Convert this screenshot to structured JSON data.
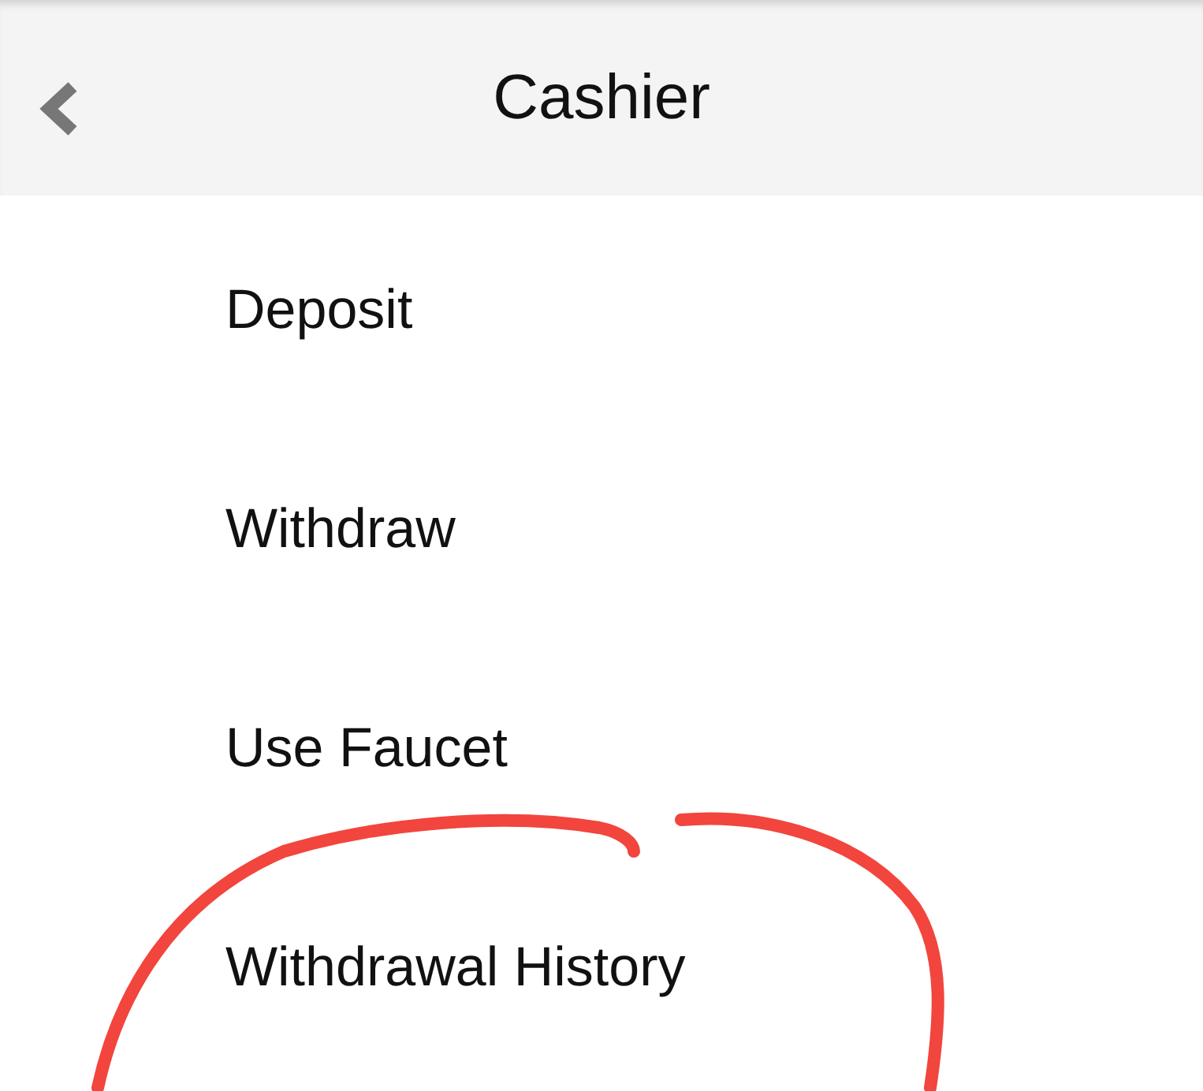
{
  "header": {
    "title": "Cashier"
  },
  "menu": [
    {
      "label": "Deposit"
    },
    {
      "label": "Withdraw"
    },
    {
      "label": "Use Faucet"
    },
    {
      "label": "Withdrawal History"
    }
  ],
  "annotation": {
    "kind": "circle",
    "color": "#f2453d"
  }
}
